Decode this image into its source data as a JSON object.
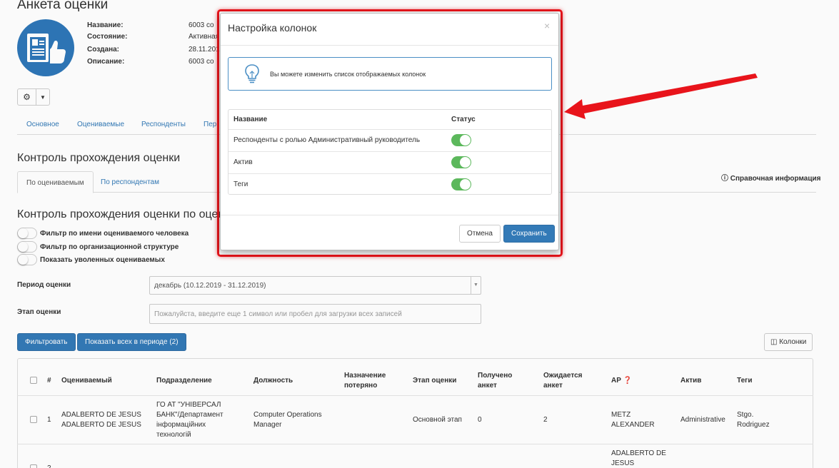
{
  "page": {
    "title": "Анкета оценки",
    "info": [
      {
        "label": "Название:",
        "value": "6003 co"
      },
      {
        "label": "Состояние:",
        "value": "Активная"
      },
      {
        "label": "Создана:",
        "value": "28.11.201"
      },
      {
        "label": "Описание:",
        "value": "6003 co"
      }
    ],
    "tabs": [
      "Основное",
      "Оцениваемые",
      "Респонденты",
      "Пер"
    ],
    "section_title": "Контроль прохождения оценки",
    "subtabs": [
      "По оцениваемым",
      "По респондентам"
    ],
    "help_link": "Справочная информация",
    "section_title2": "Контроль прохождения оценки по оценива",
    "filters": [
      "Фильтр по имени оцениваемого человека",
      "Фильтр по организационной структуре",
      "Показать уволенных оцениваемых"
    ],
    "period_label": "Период оценки",
    "period_value": "декабрь (10.12.2019 - 31.12.2019)",
    "stage_label": "Этап оценки",
    "stage_placeholder": "Пожалуйста, введите еще 1 символ или пробел для загрузки всех записей",
    "filter_btn": "Фильтровать",
    "show_all_btn": "Показать всех в периоде (2)",
    "columns_btn": "Колонки"
  },
  "table": {
    "headers": [
      "#",
      "Оцениваемый",
      "Подразделение",
      "Должность",
      "Назначение потеряно",
      "Этап оценки",
      "Получено анкет",
      "Ожидается анкет",
      "АР",
      "Актив",
      "Теги"
    ],
    "rows": [
      {
        "n": "1",
        "name": "ADALBERTO DE JESUS ADALBERTO DE JESUS",
        "dept": "ГО АТ \"УНІВЕРСАЛ БАНК\"/Департамент інформаційних технологій",
        "position": "Computer Operations Manager",
        "lost": "",
        "stage": "Основной этап",
        "received": "0",
        "expected": "2",
        "ap": "METZ ALEXANDER",
        "active": "Administrative",
        "tags": "Stgo. Rodriguez"
      },
      {
        "n": "2",
        "name": "",
        "dept": "",
        "position": "",
        "lost": "",
        "stage": "",
        "received": "",
        "expected": "",
        "ap": "ADALBERTO DE JESUS",
        "active": "",
        "tags": ""
      }
    ]
  },
  "modal": {
    "title": "Настройка колонок",
    "close": "×",
    "info": "Вы можете изменить список отображаемых колонок",
    "col_name": "Название",
    "col_status": "Статус",
    "items": [
      {
        "name": "Респонденты с ролью Административный руководитель",
        "on": true
      },
      {
        "name": "Актив",
        "on": true
      },
      {
        "name": "Теги",
        "on": true
      }
    ],
    "cancel": "Отмена",
    "save": "Сохранить"
  },
  "colors": {
    "accent": "#337ab7",
    "switch_on": "#5cb85c",
    "annotation": "#e8141b"
  }
}
